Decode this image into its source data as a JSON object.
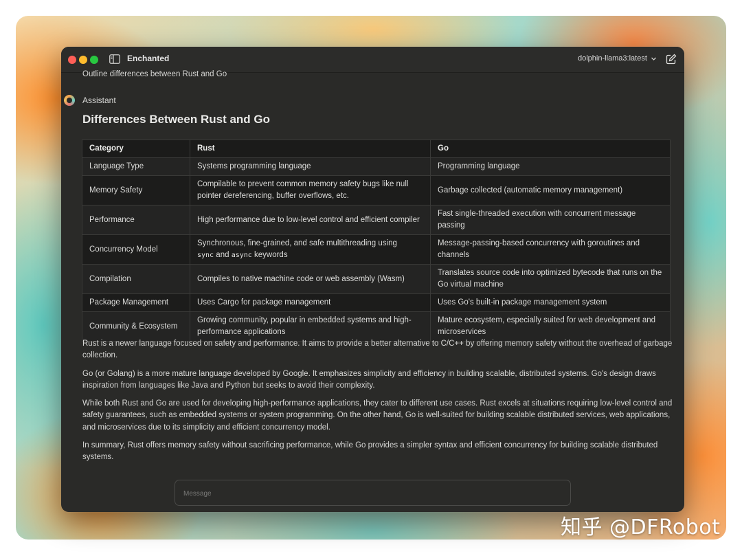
{
  "window": {
    "title": "Enchanted",
    "model": "dolphin-llama3:latest"
  },
  "icons": {
    "sidebar_toggle": "sidebar-icon",
    "model_dropdown": "chevron-down-icon",
    "new_chat": "new-chat-icon"
  },
  "chat": {
    "user_message": "Outline differences between Rust and Go",
    "assistant_label": "Assistant",
    "heading": "Differences Between Rust and Go",
    "table": {
      "headers": [
        "Category",
        "Rust",
        "Go"
      ],
      "rows": [
        {
          "category": "Language Type",
          "rust": "Systems programming language",
          "go": "Programming language"
        },
        {
          "category": "Memory Safety",
          "rust": "Compilable to prevent common memory safety bugs like null pointer dereferencing, buffer overflows, etc.",
          "go": "Garbage collected (automatic memory management)"
        },
        {
          "category": "Performance",
          "rust": "High performance due to low-level control and efficient compiler",
          "go": "Fast single-threaded execution with concurrent message passing"
        },
        {
          "category": "Concurrency Model",
          "rust_pre": "Synchronous, fine-grained, and safe multithreading using",
          "rust_code1": "sync",
          "rust_and": "and",
          "rust_code2": "async",
          "rust_post": "keywords",
          "go": "Message-passing-based concurrency with goroutines and channels"
        },
        {
          "category": "Compilation",
          "rust": "Compiles to native machine code or web assembly (Wasm)",
          "go": "Translates source code into optimized bytecode that runs on the Go virtual machine"
        },
        {
          "category": "Package Management",
          "rust": "Uses Cargo for package management",
          "go": "Uses Go's built-in package management system"
        },
        {
          "category": "Community & Ecosystem",
          "rust": "Growing community, popular in embedded systems and high-performance applications",
          "go": "Mature ecosystem, especially suited for web development and microservices"
        }
      ]
    },
    "paragraphs": [
      "Rust is a newer language focused on safety and performance. It aims to provide a better alternative to C/C++ by offering memory safety without the overhead of garbage collection.",
      "Go (or Golang) is a more mature language developed by Google. It emphasizes simplicity and efficiency in building scalable, distributed systems. Go's design draws inspiration from languages like Java and Python but seeks to avoid their complexity.",
      "While both Rust and Go are used for developing high-performance applications, they cater to different use cases. Rust excels at situations requiring low-level control and safety guarantees, such as embedded systems or system programming. On the other hand, Go is well-suited for building scalable distributed services, web applications, and microservices due to its simplicity and efficient concurrency model.",
      "In summary, Rust offers memory safety without sacrificing performance, while Go provides a simpler syntax and efficient concurrency for building scalable distributed systems."
    ],
    "input": {
      "placeholder": "Message",
      "value": ""
    }
  },
  "watermark": "知乎 @DFRobot"
}
